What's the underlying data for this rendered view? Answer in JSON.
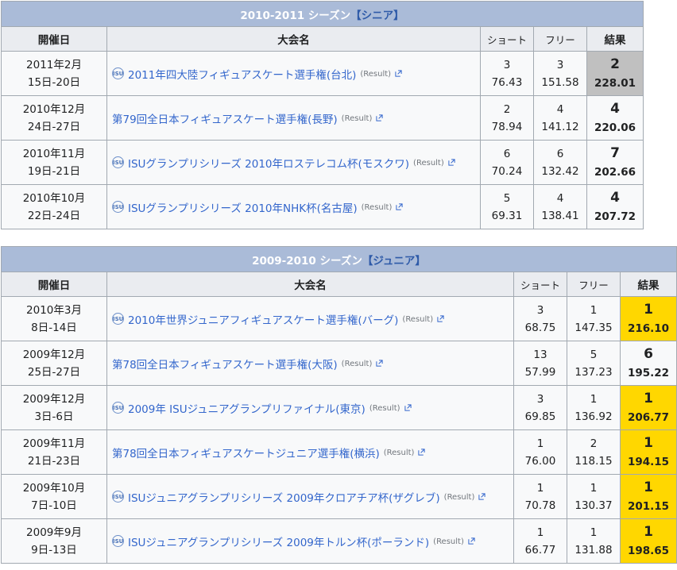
{
  "labels": {
    "col_date": "開催日",
    "col_event": "大会名",
    "col_short": "ショート",
    "col_free": "フリー",
    "col_result": "結果",
    "result_link": "Result",
    "isu_icon_text": "ISU"
  },
  "seasons": [
    {
      "title": "2010-2011 シーズン",
      "level": "【シニア】",
      "rows": [
        {
          "date1": "2011年2月",
          "date2": "15日-20日",
          "isu": true,
          "event": "2011年四大陸フィギュアスケート選手権(台北)",
          "short_place": "3",
          "short_score": "76.43",
          "free_place": "3",
          "free_score": "151.58",
          "place": "2",
          "total": "228.01",
          "medal": "silver"
        },
        {
          "date1": "2010年12月",
          "date2": "24日-27日",
          "isu": false,
          "event": "第79回全日本フィギュアスケート選手権(長野)",
          "short_place": "2",
          "short_score": "78.94",
          "free_place": "4",
          "free_score": "141.12",
          "place": "4",
          "total": "220.06",
          "medal": ""
        },
        {
          "date1": "2010年11月",
          "date2": "19日-21日",
          "isu": true,
          "event": "ISUグランプリシリーズ 2010年ロステレコム杯(モスクワ)",
          "short_place": "6",
          "short_score": "70.24",
          "free_place": "6",
          "free_score": "132.42",
          "place": "7",
          "total": "202.66",
          "medal": ""
        },
        {
          "date1": "2010年10月",
          "date2": "22日-24日",
          "isu": true,
          "event": "ISUグランプリシリーズ 2010年NHK杯(名古屋)",
          "short_place": "5",
          "short_score": "69.31",
          "free_place": "4",
          "free_score": "138.41",
          "place": "4",
          "total": "207.72",
          "medal": ""
        }
      ]
    },
    {
      "title": "2009-2010 シーズン",
      "level": "【ジュニア】",
      "rows": [
        {
          "date1": "2010年3月",
          "date2": "8日-14日",
          "isu": true,
          "event": "2010年世界ジュニアフィギュアスケート選手権(バーグ)",
          "short_place": "3",
          "short_score": "68.75",
          "free_place": "1",
          "free_score": "147.35",
          "place": "1",
          "total": "216.10",
          "medal": "gold"
        },
        {
          "date1": "2009年12月",
          "date2": "25日-27日",
          "isu": false,
          "event": "第78回全日本フィギュアスケート選手権(大阪)",
          "short_place": "13",
          "short_score": "57.99",
          "free_place": "5",
          "free_score": "137.23",
          "place": "6",
          "total": "195.22",
          "medal": ""
        },
        {
          "date1": "2009年12月",
          "date2": "3日-6日",
          "isu": true,
          "event": "2009年 ISUジュニアグランプリファイナル(東京)",
          "short_place": "3",
          "short_score": "69.85",
          "free_place": "1",
          "free_score": "136.92",
          "place": "1",
          "total": "206.77",
          "medal": "gold"
        },
        {
          "date1": "2009年11月",
          "date2": "21日-23日",
          "isu": false,
          "event": "第78回全日本フィギュアスケートジュニア選手権(横浜)",
          "short_place": "1",
          "short_score": "76.00",
          "free_place": "2",
          "free_score": "118.15",
          "place": "1",
          "total": "194.15",
          "medal": "gold"
        },
        {
          "date1": "2009年10月",
          "date2": "7日-10日",
          "isu": true,
          "event": "ISUジュニアグランプリシリーズ 2009年クロアチア杯(ザグレブ)",
          "short_place": "1",
          "short_score": "70.78",
          "free_place": "1",
          "free_score": "130.37",
          "place": "1",
          "total": "201.15",
          "medal": "gold"
        },
        {
          "date1": "2009年9月",
          "date2": "9日-13日",
          "isu": true,
          "event": "ISUジュニアグランプリシリーズ 2009年トルン杯(ポーランド)",
          "short_place": "1",
          "short_score": "66.77",
          "free_place": "1",
          "free_score": "131.88",
          "place": "1",
          "total": "198.65",
          "medal": "gold"
        }
      ]
    }
  ],
  "colors": {
    "header_bg": "#aabbd8",
    "gold": "#ffd700",
    "silver": "#c0c0c0",
    "link": "#3366cc"
  }
}
